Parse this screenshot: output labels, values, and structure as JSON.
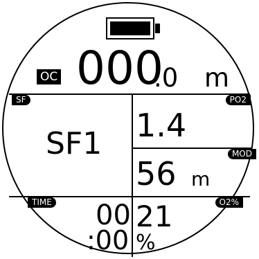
{
  "battery": {
    "icon": "battery-full-icon",
    "level": 1.0
  },
  "header": {
    "mode_badge": "OC",
    "depth_main": "000",
    "depth_decimal": ".0",
    "depth_unit": "m"
  },
  "fields": {
    "sf": {
      "label": "SF",
      "value": "SF1"
    },
    "po2": {
      "label": "PO2",
      "value": "1.4"
    },
    "mod": {
      "label": "MOD",
      "value": "56",
      "unit": "m"
    },
    "time": {
      "label": "TIME",
      "value_line1": "00",
      "value_line2": ":00"
    },
    "o2": {
      "label": "O2%",
      "value": "21",
      "unit": "%"
    }
  }
}
